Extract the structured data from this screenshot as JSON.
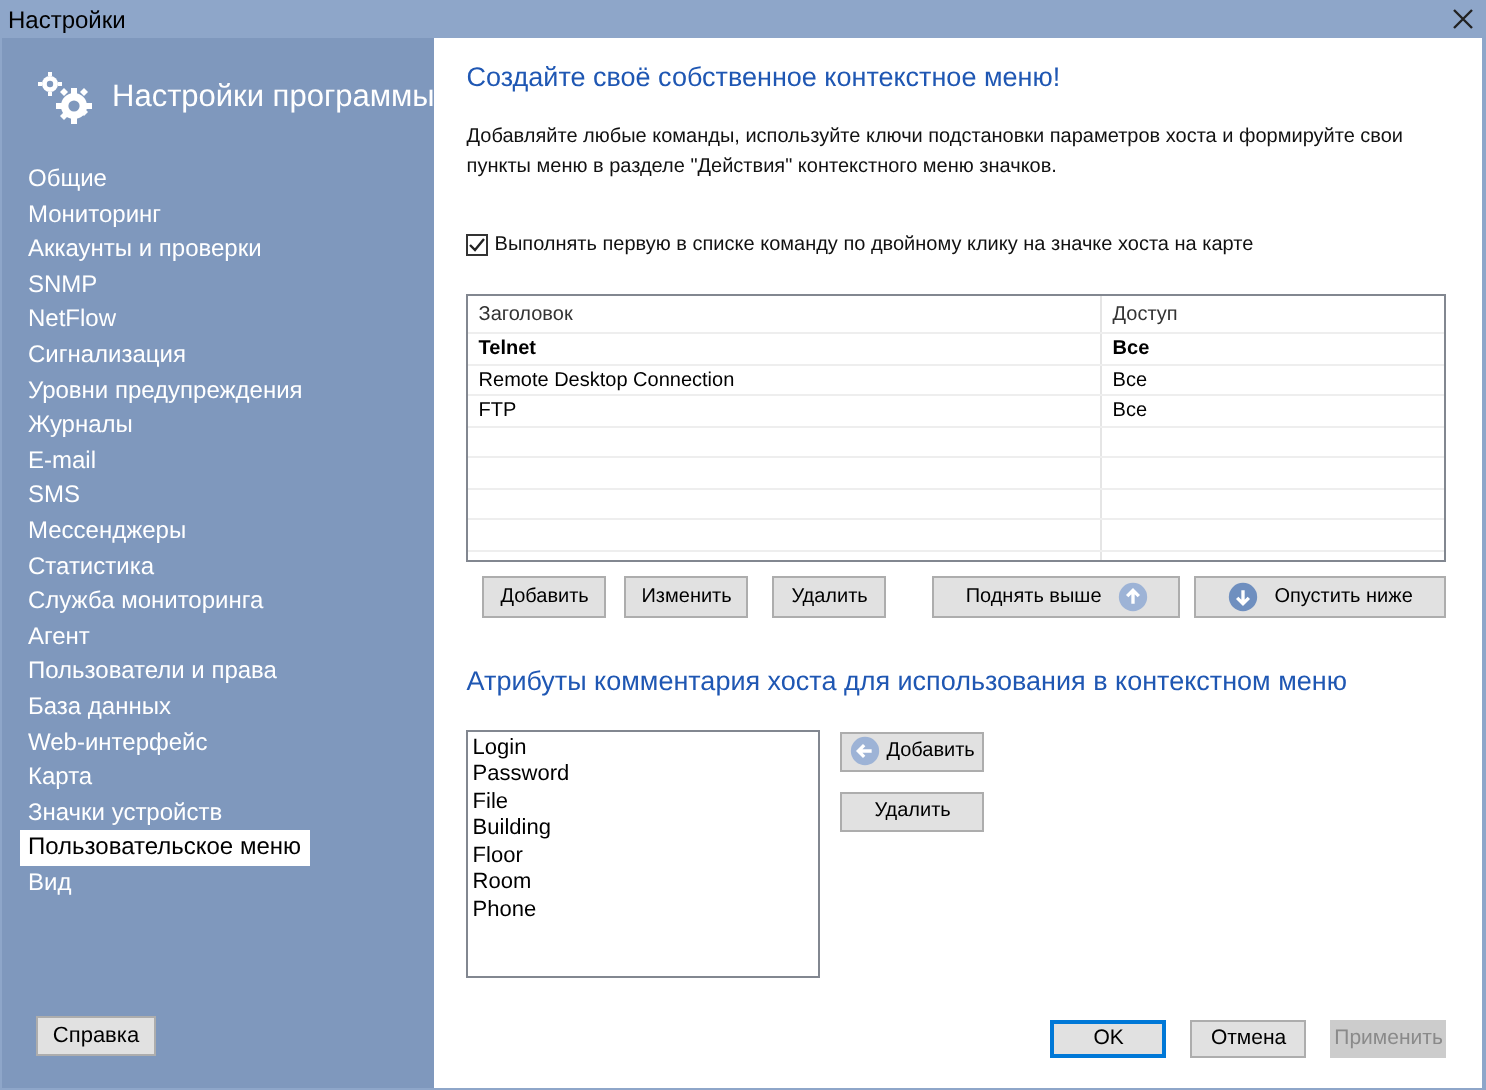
{
  "window": {
    "title": "Настройки"
  },
  "sidebar": {
    "title": "Настройки программы",
    "items": [
      {
        "label": "Общие",
        "selected": false
      },
      {
        "label": "Мониторинг",
        "selected": false
      },
      {
        "label": "Аккаунты и проверки",
        "selected": false
      },
      {
        "label": "SNMP",
        "selected": false
      },
      {
        "label": "NetFlow",
        "selected": false
      },
      {
        "label": "Сигнализация",
        "selected": false
      },
      {
        "label": "Уровни предупреждения",
        "selected": false
      },
      {
        "label": "Журналы",
        "selected": false
      },
      {
        "label": "E-mail",
        "selected": false
      },
      {
        "label": "SMS",
        "selected": false
      },
      {
        "label": "Мессенджеры",
        "selected": false
      },
      {
        "label": "Статистика",
        "selected": false
      },
      {
        "label": "Служба мониторинга",
        "selected": false
      },
      {
        "label": "Агент",
        "selected": false
      },
      {
        "label": "Пользователи и права",
        "selected": false
      },
      {
        "label": "База данных",
        "selected": false
      },
      {
        "label": "Web-интерфейс",
        "selected": false
      },
      {
        "label": "Карта",
        "selected": false
      },
      {
        "label": "Значки устройств",
        "selected": false
      },
      {
        "label": "Пользовательское меню",
        "selected": true
      },
      {
        "label": "Вид",
        "selected": false
      }
    ],
    "help_button": "Справка"
  },
  "content": {
    "heading": "Создайте своё собственное контекстное меню!",
    "description": "Добавляйте любые команды, используйте ключи подстановки параметров хоста и формируйте свои пункты меню в разделе \"Действия\" контекстного меню значков.",
    "double_click_option": {
      "label": "Выполнять первую в списке команду по двойному клику на значке хоста на карте",
      "checked": true
    },
    "table": {
      "columns": [
        "Заголовок",
        "Доступ"
      ],
      "rows": [
        {
          "cells": [
            "Telnet",
            "Все"
          ],
          "bold": true
        },
        {
          "cells": [
            "Remote Desktop Connection",
            "Все"
          ],
          "bold": false
        },
        {
          "cells": [
            "FTP",
            "Все"
          ],
          "bold": false
        }
      ]
    },
    "table_buttons": [
      {
        "label": "Добавить",
        "kind": "plain"
      },
      {
        "label": "Изменить",
        "kind": "plain"
      },
      {
        "label": "Удалить",
        "kind": "plain"
      },
      {
        "label": "Поднять выше",
        "kind": "up"
      },
      {
        "label": "Опустить ниже",
        "kind": "down"
      }
    ],
    "attributes_heading": "Атрибуты комментария хоста для использования в контекстном меню",
    "attributes": [
      "Login",
      "Password",
      "File",
      "Building",
      "Floor",
      "Room",
      "Phone"
    ],
    "attribute_buttons": [
      {
        "label": "Добавить",
        "kind": "left"
      },
      {
        "label": "Удалить",
        "kind": "plain"
      }
    ]
  },
  "footer_buttons": [
    {
      "label": "OK",
      "default": true,
      "disabled": false
    },
    {
      "label": "Отмена",
      "default": false,
      "disabled": false
    },
    {
      "label": "Применить",
      "default": false,
      "disabled": true
    }
  ]
}
